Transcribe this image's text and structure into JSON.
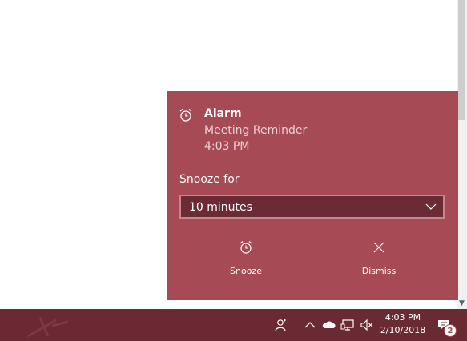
{
  "colors": {
    "toast_background": "#a64a55",
    "snooze_field_background": "#6b2b35",
    "taskbar_background": "#6a2a33",
    "page_background": "#ffffff"
  },
  "toast": {
    "app_icon": "alarm-clock-icon",
    "title": "Alarm",
    "body": "Meeting Reminder",
    "time": "4:03 PM",
    "snooze_label": "Snooze for",
    "snooze_selected": "10 minutes",
    "snooze_chevron_icon": "chevron-down-icon",
    "actions": [
      {
        "label": "Snooze",
        "icon": "alarm-clock-icon"
      },
      {
        "label": "Dismiss",
        "icon": "close-icon"
      }
    ]
  },
  "taskbar": {
    "tray_icons": [
      "people-icon",
      "chevron-up-icon",
      "onedrive-cloud-icon",
      "network-icon",
      "volume-muted-icon"
    ],
    "clock_time": "4:03 PM",
    "clock_date": "2/10/2018",
    "action_center_icon": "action-center-icon",
    "notification_count": "2"
  }
}
